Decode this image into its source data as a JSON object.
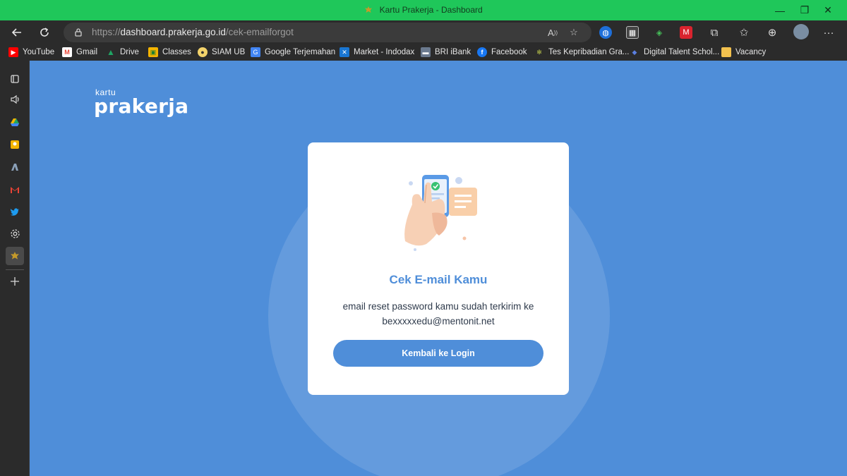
{
  "window": {
    "title": "Kartu Prakerja - Dashboard",
    "controls": {
      "minimize": "—",
      "restore": "❐",
      "close": "✕"
    }
  },
  "navbar": {
    "url_scheme": "https://",
    "url_host": "dashboard.prakerja.go.id",
    "url_path": "/cek-emailforgot",
    "read_aloud_label": "Aͅ",
    "icons": [
      "back-icon",
      "refresh-icon",
      "lock-icon",
      "read-aloud-icon",
      "add-favorite-icon",
      "extensions-icon",
      "favorites-icon",
      "collections-icon",
      "profile-avatar",
      "more-icon"
    ]
  },
  "bookmarks": [
    {
      "label": "YouTube",
      "color": "#ff0000",
      "glyph": "▶"
    },
    {
      "label": "Gmail",
      "color": "#ea4335",
      "glyph": "M"
    },
    {
      "label": "Drive",
      "color": "#1fa463",
      "glyph": "▲"
    },
    {
      "label": "Classes",
      "color": "#f4b400",
      "glyph": "▣"
    },
    {
      "label": "SIAM UB",
      "color": "#d4a017",
      "glyph": "●"
    },
    {
      "label": "Google Terjemahan",
      "color": "#4285f4",
      "glyph": "G"
    },
    {
      "label": "Market - Indodax",
      "color": "#1976d2",
      "glyph": "✕"
    },
    {
      "label": "BRI iBank",
      "color": "#6b7a8f",
      "glyph": "▬"
    },
    {
      "label": "Facebook",
      "color": "#1877f2",
      "glyph": "f"
    },
    {
      "label": "Tes Kepribadian Gra...",
      "color": "#8d9b3b",
      "glyph": "✻"
    },
    {
      "label": "Digital Talent Schol...",
      "color": "#2b4aa0",
      "glyph": "◆"
    },
    {
      "label": "Vacancy",
      "color": "#f2c14e",
      "glyph": "▬"
    }
  ],
  "sidebar": {
    "icons": [
      "tabs-icon",
      "speaker-icon",
      "drive-icon",
      "keep-icon",
      "office-icon",
      "gmail-icon",
      "twitter-icon",
      "settings-icon",
      "prakerja-icon",
      "add-icon"
    ]
  },
  "page": {
    "logo_small": "kartu",
    "logo_big": "prakerja",
    "card": {
      "title": "Cek E-mail Kamu",
      "message_line1": "email reset password kamu sudah terkirim ke",
      "message_line2": "bexxxxxedu@mentonit.net",
      "button_label": "Kembali ke Login"
    },
    "colors": {
      "accent": "#4f8ed9",
      "titlebar": "#1fc75a",
      "card": "#ffffff"
    }
  }
}
